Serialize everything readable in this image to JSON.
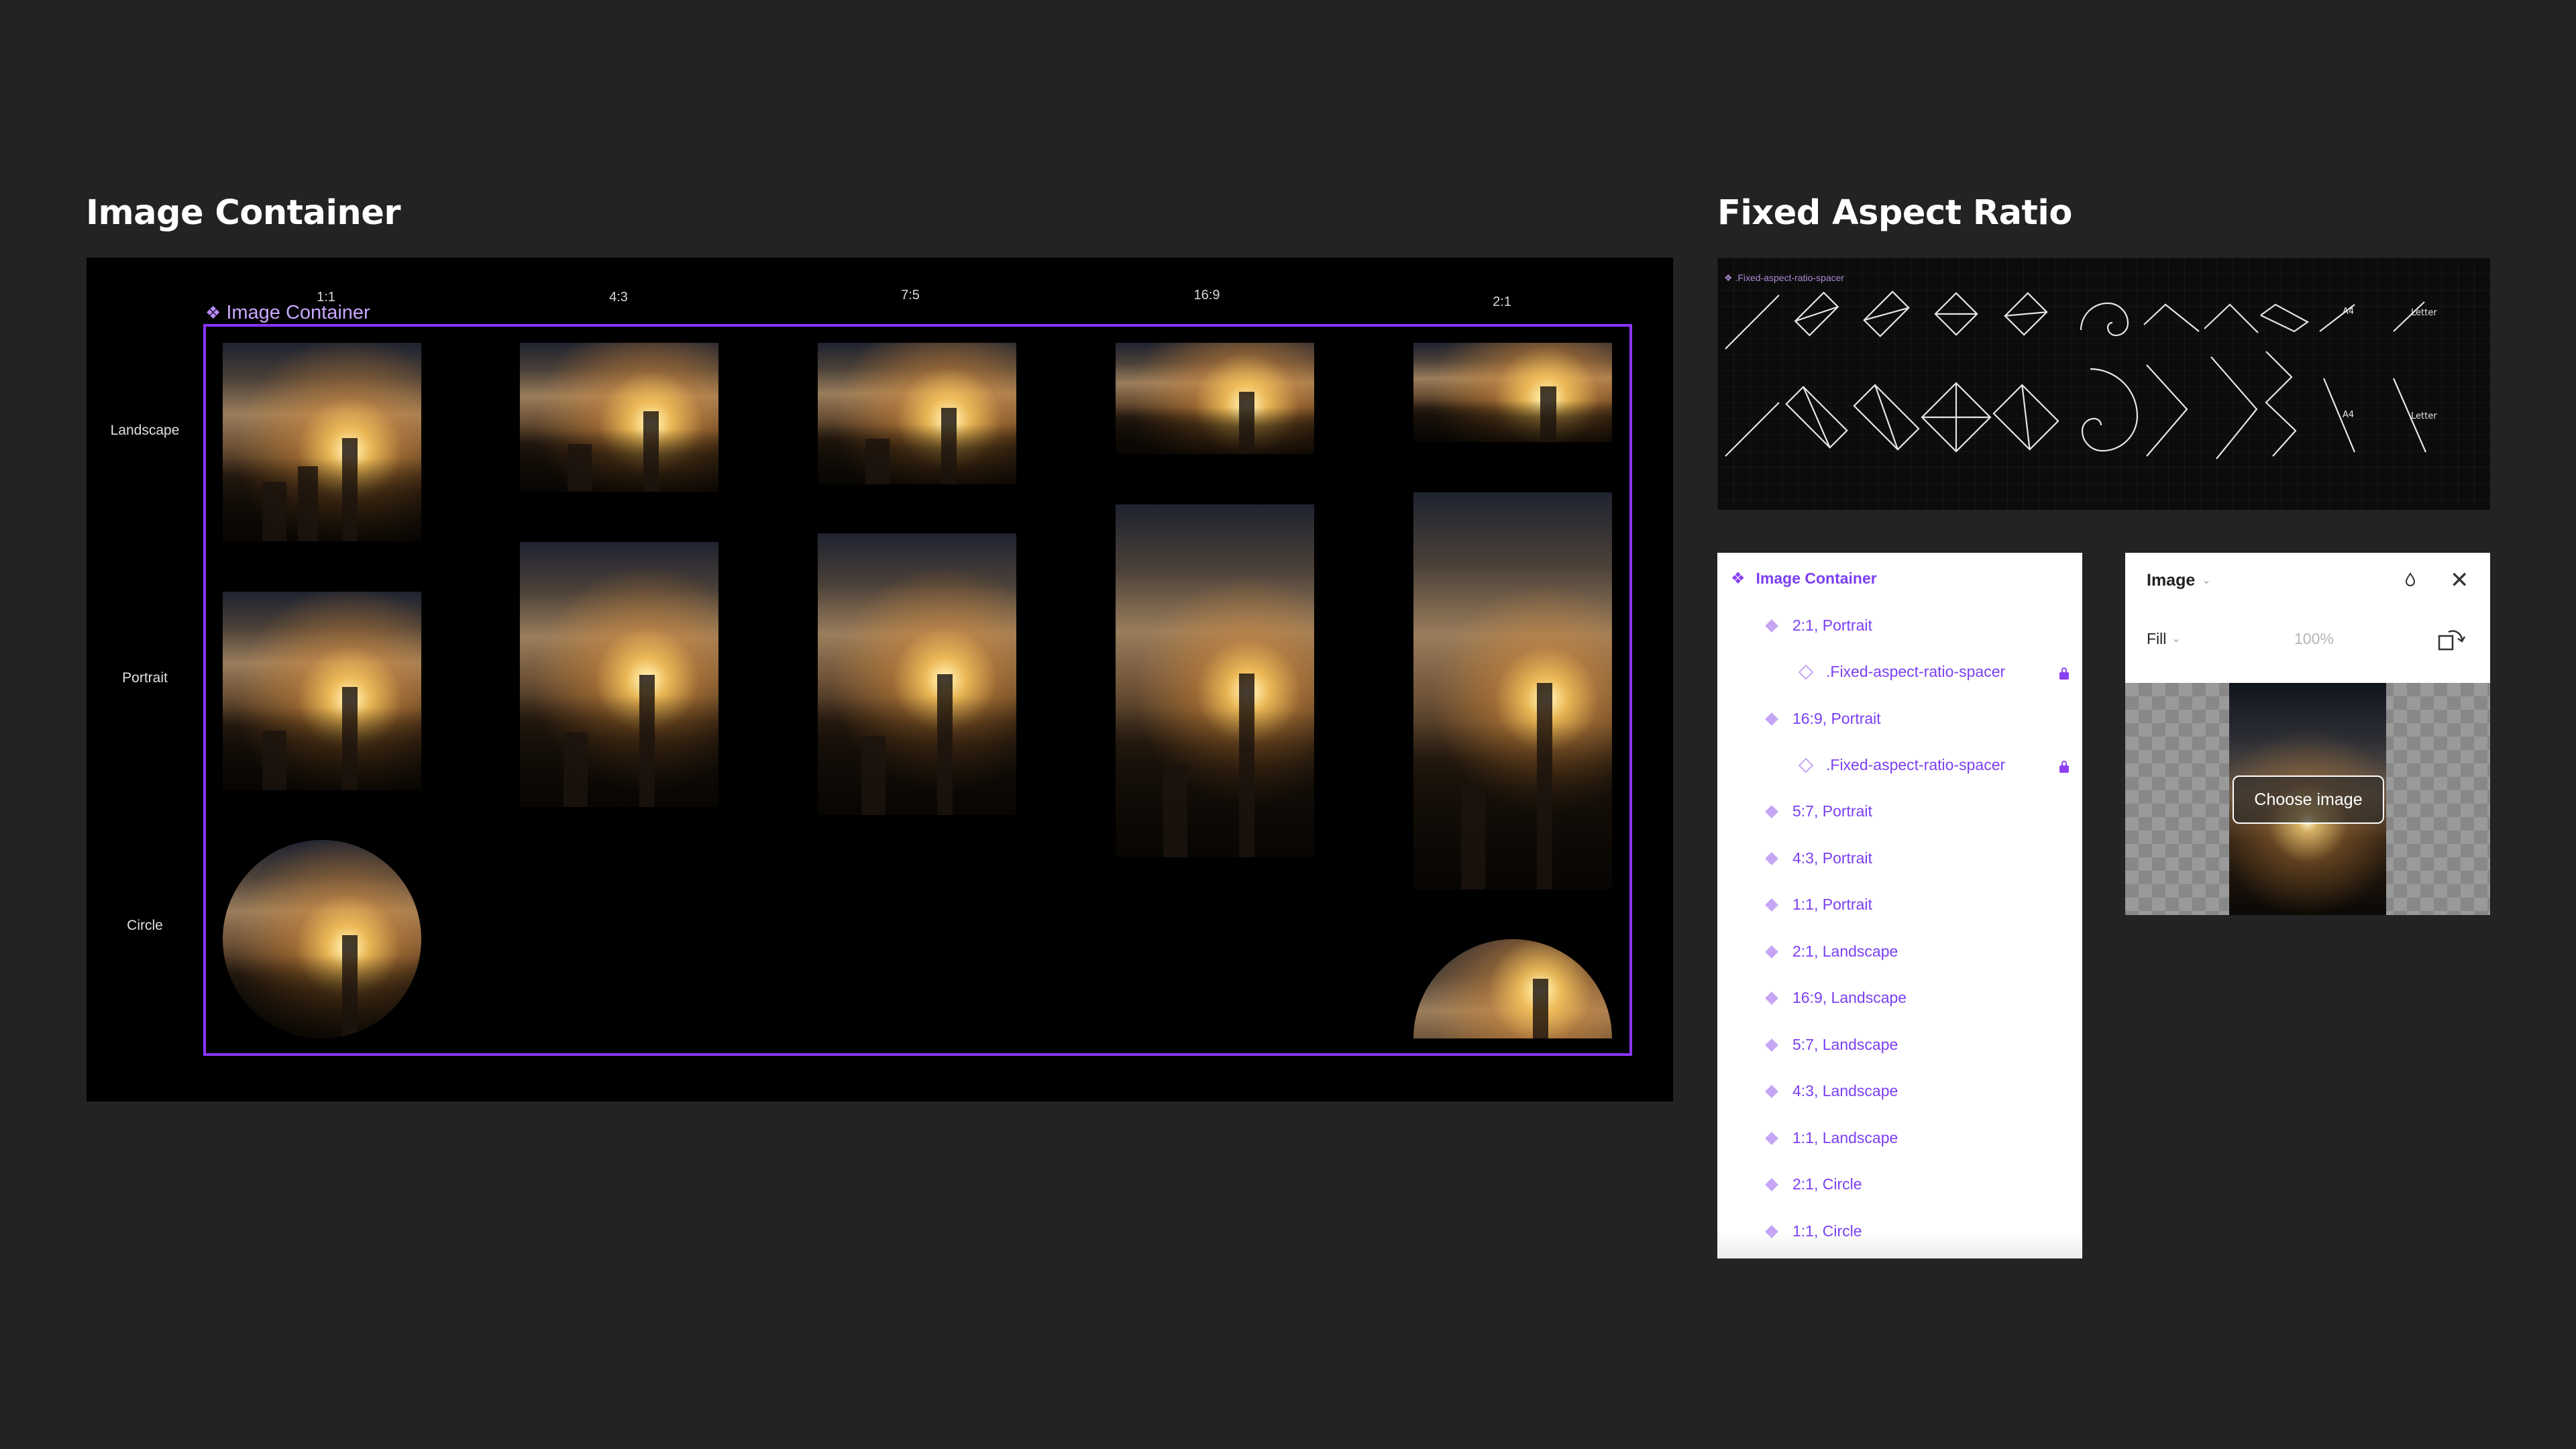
{
  "left_section": {
    "title": "Image Container",
    "component_tag": "Image Container",
    "column_labels": [
      "1:1",
      "4:3",
      "7:5",
      "16:9",
      "2:1"
    ],
    "row_labels": [
      "Landscape",
      "Portrait",
      "Circle"
    ]
  },
  "right_section": {
    "title": "Fixed Aspect Ratio",
    "spacer_tag": ".Fixed-aspect-ratio-spacer",
    "shape_labels": [
      "A4",
      "Letter",
      "A4",
      "Letter"
    ]
  },
  "layers_panel": {
    "root": "Image Container",
    "items": [
      {
        "label": "2:1, Portrait",
        "type": "instance",
        "locked": false
      },
      {
        "label": ".Fixed-aspect-ratio-spacer",
        "type": "spacer",
        "locked": true
      },
      {
        "label": "16:9, Portrait",
        "type": "instance",
        "locked": false
      },
      {
        "label": ".Fixed-aspect-ratio-spacer",
        "type": "spacer",
        "locked": true
      },
      {
        "label": "5:7, Portrait",
        "type": "instance",
        "locked": false
      },
      {
        "label": "4:3, Portrait",
        "type": "instance",
        "locked": false
      },
      {
        "label": "1:1, Portrait",
        "type": "instance",
        "locked": false
      },
      {
        "label": "2:1, Landscape",
        "type": "instance",
        "locked": false
      },
      {
        "label": "16:9, Landscape",
        "type": "instance",
        "locked": false
      },
      {
        "label": "5:7, Landscape",
        "type": "instance",
        "locked": false
      },
      {
        "label": "4:3, Landscape",
        "type": "instance",
        "locked": false
      },
      {
        "label": "1:1, Landscape",
        "type": "instance",
        "locked": false
      },
      {
        "label": "2:1, Circle",
        "type": "instance",
        "locked": false
      },
      {
        "label": "1:1, Circle",
        "type": "instance",
        "locked": false
      }
    ]
  },
  "fill_panel": {
    "title": "Image",
    "mode": "Fill",
    "opacity": "100%",
    "choose_button": "Choose image"
  },
  "colors": {
    "background": "#232323",
    "accent": "#8b35ff",
    "layer_text": "#7b3ff2"
  }
}
